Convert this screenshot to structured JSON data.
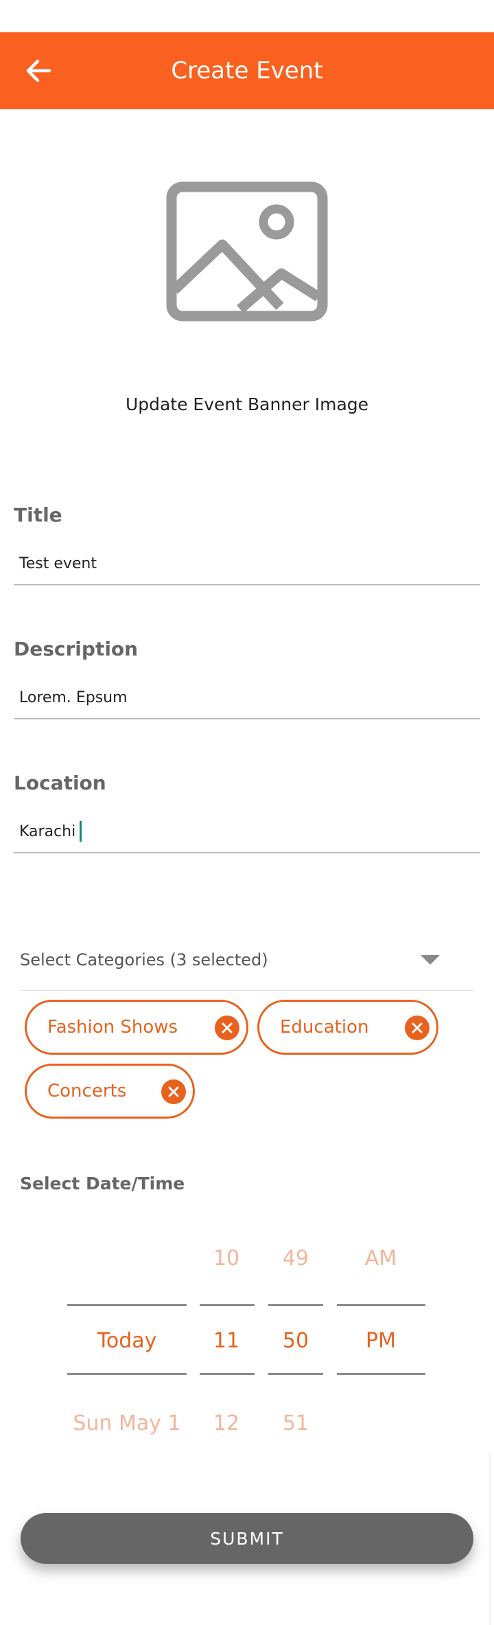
{
  "header": {
    "title": "Create Event",
    "back_icon": "arrow-left-icon"
  },
  "banner": {
    "icon": "image-placeholder-icon",
    "label": "Update Event Banner Image"
  },
  "form": {
    "title": {
      "label": "Title",
      "value": "Test event"
    },
    "description": {
      "label": "Description",
      "value": "Lorem. Epsum"
    },
    "location": {
      "label": "Location",
      "value": "Karachi"
    }
  },
  "categories": {
    "select_label": "Select Categories (3 selected)",
    "chips": [
      "Fashion Shows",
      "Education",
      "Concerts"
    ]
  },
  "datetime": {
    "label": "Select Date/Time",
    "above": {
      "hour": "10",
      "minute": "49",
      "ampm": "AM"
    },
    "selected": {
      "date": "Today",
      "hour": "11",
      "minute": "50",
      "ampm": "PM"
    },
    "below": {
      "date": "Sun May 1",
      "hour": "12",
      "minute": "51"
    }
  },
  "submit_label": "SUBMIT",
  "colors": {
    "accent": "#fa6120",
    "chip": "#e8621e",
    "faded": "#f4b59b",
    "submit": "#666666"
  }
}
